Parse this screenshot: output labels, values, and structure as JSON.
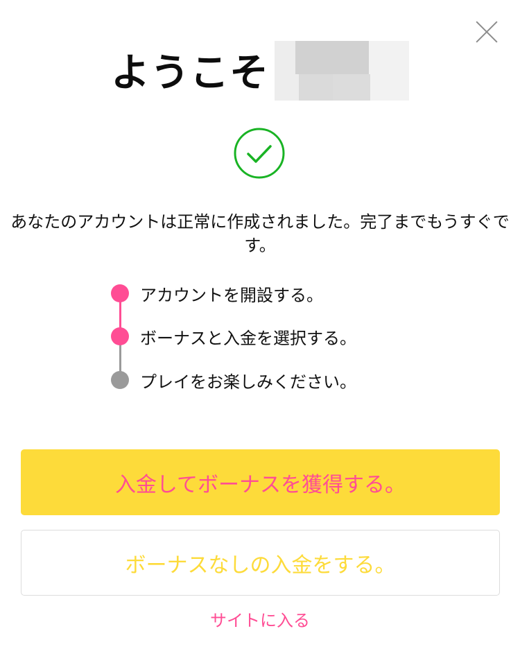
{
  "header": {
    "title": "ようこそ",
    "close_icon": "close-icon"
  },
  "status": {
    "icon": "check-circle-icon",
    "color": "#19b324",
    "message": "あなたのアカウントは正常に作成されました。完了までもうすぐです。"
  },
  "steps": [
    {
      "label": "アカウントを開設する。",
      "state": "done",
      "color": "#ff4d94"
    },
    {
      "label": "ボーナスと入金を選択する。",
      "state": "current",
      "color": "#ff4d94"
    },
    {
      "label": "プレイをお楽しみください。",
      "state": "pending",
      "color": "#9a9a9a"
    }
  ],
  "actions": {
    "deposit_bonus_label": "入金してボーナスを獲得する。",
    "deposit_no_bonus_label": "ボーナスなしの入金をする。",
    "enter_site_label": "サイトに入る"
  },
  "colors": {
    "accent_pink": "#ff4d94",
    "accent_yellow": "#fddb3a",
    "success_green": "#19b324"
  }
}
